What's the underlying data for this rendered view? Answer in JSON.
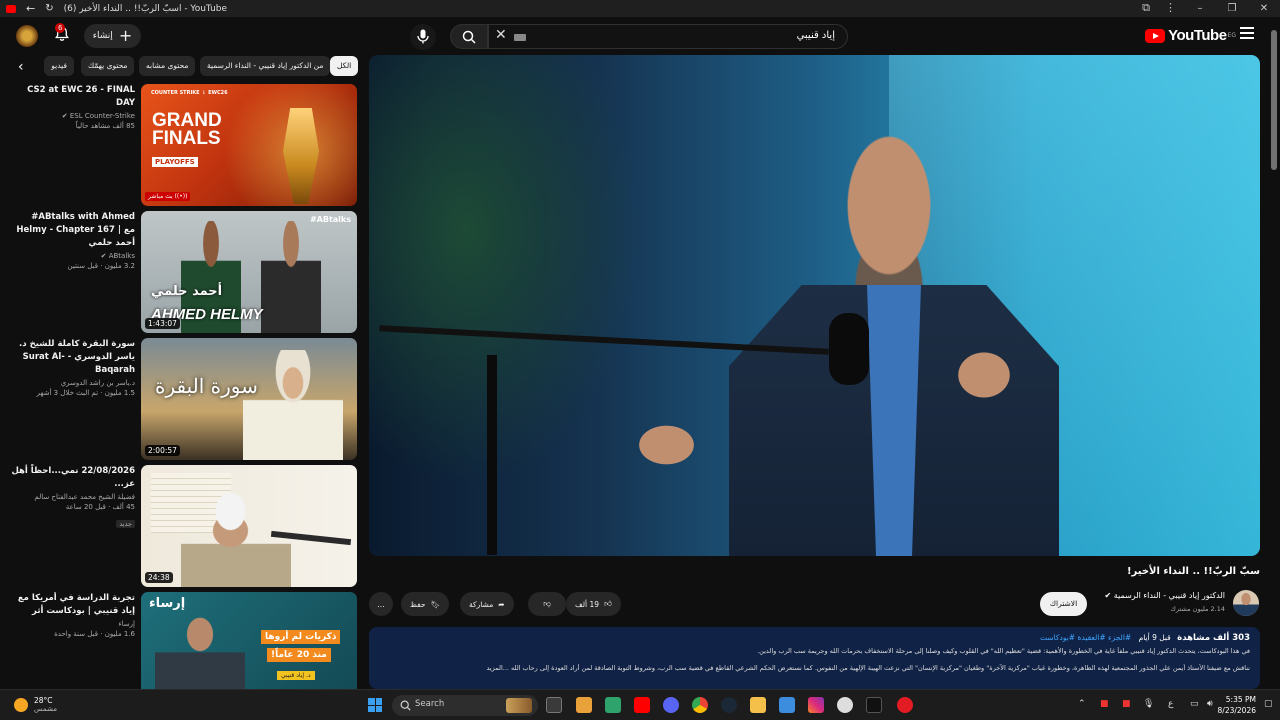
{
  "window": {
    "tab_title": "(6) اسبّ الربّ!! .. النداء الأخير - YouTube",
    "app_name": "YouTube"
  },
  "header": {
    "logo_text": "YouTube",
    "logo_sup": "EG",
    "search_query": "إياد قنيبي",
    "create_label": "إنشاء",
    "notification_count": "6"
  },
  "chips": {
    "items": [
      "الكل",
      "من الدكتور إياد قنيبي - النداء الرسمية",
      "محتوى مشابه",
      "محتوى يهمّك",
      "فيديو"
    ],
    "active_index": 0
  },
  "recommendations": [
    {
      "title": "CS2 at EWC 26 - FINAL DAY",
      "channel": "ESL Counter-Strike",
      "meta": "85 ألف مشاهد حالياً",
      "duration": "",
      "live_badge": "بث مباشر",
      "thumb_text_1": "GRAND",
      "thumb_text_2": "FINALS",
      "thumb_text_3": "PLAYOFFS",
      "thumb_brand": "EWC26"
    },
    {
      "title": "#ABtalks with Ahmed Helmy - Chapter 167 | مع أحمد حلمي",
      "channel": "ABtalks",
      "meta": "3.2 مليون · قبل سنتين",
      "duration": "1:43:07",
      "thumb_text_1": "أحمد حلمي",
      "thumb_text_2": "AHMED HELMY",
      "thumb_brand": "#ABtalks"
    },
    {
      "title": "سورة البقرة كاملة للشيخ د. ياسر الدوسري - Surat Al-Baqarah",
      "channel": "د.ياسر بن راشد الدوسري",
      "meta": "1.5 مليون · تم البث خلال 3 أشهر",
      "duration": "2:00:57",
      "thumb_text_1": "سورة البقرة"
    },
    {
      "title": "22/08/2026 نمي...احظاً أهل عز...",
      "channel": "فضيلة الشيخ محمد عبدالفتاح سالم",
      "meta": "45 ألف · قبل 20 ساعة",
      "new_label": "جديد",
      "duration": "24:38"
    },
    {
      "title": "تجربة الدراسة في أمريكا مع إياد قنيبي | بودكاست أثر",
      "channel": "إرساء",
      "meta": "1.6 مليون · قبل سنة واحدة",
      "duration": "",
      "thumb_text_1": "إرساء",
      "thumb_text_2": "ذكريات لم أروها",
      "thumb_text_3": "منذ 20 عاماً!",
      "thumb_text_4": "د. إياد قنيبي"
    }
  ],
  "video": {
    "title": "سبّ الربّ!! .. النداء الأخير!",
    "channel_name": "الدكتور إياد قنيبي - النداء الرسمية",
    "subscribers": "2.14 مليون مشترك",
    "subscribe_label": "الاشتراك",
    "likes": "19 ألف",
    "share_label": "مشاركة",
    "save_label": "حفظ",
    "more_label": "..."
  },
  "description": {
    "views": "303 ألف مشاهدة",
    "age": "قبل 9 أيام",
    "hashtags": "#الجزء #العقيدة #بودكاست",
    "line2": "في هذا البودكاست، يتحدث الدكتور إياد قنيبي ملفاً غاية في الخطورة والأهمية: قضية \"تعظيم الله\" في القلوب وكيف وصلنا إلى مرحلة الاستخفاف بحرمات الله وجريمة سب الرب والدين.",
    "line3": "نناقش مع ضيفنا الأستاذ أيمن علي الجذور المجتمعية لهذه الظاهرة، وخطورة غياب \"مركزية الآخرة\" وطغيان \"مركزية الإنسان\" التي نزعت الهيبة الإلهية من النفوس. كما نستعرض الحكم الشرعي القاطع في قضية سب الرب، وشروط التوبة الصادقة لمن أراد العودة إلى رحاب الله ...المزيد"
  },
  "taskbar": {
    "temperature": "28°C",
    "weather": "مشمس",
    "search_label": "Search",
    "time": "5:35 PM",
    "date": "8/23/2026",
    "lang": "ع"
  }
}
